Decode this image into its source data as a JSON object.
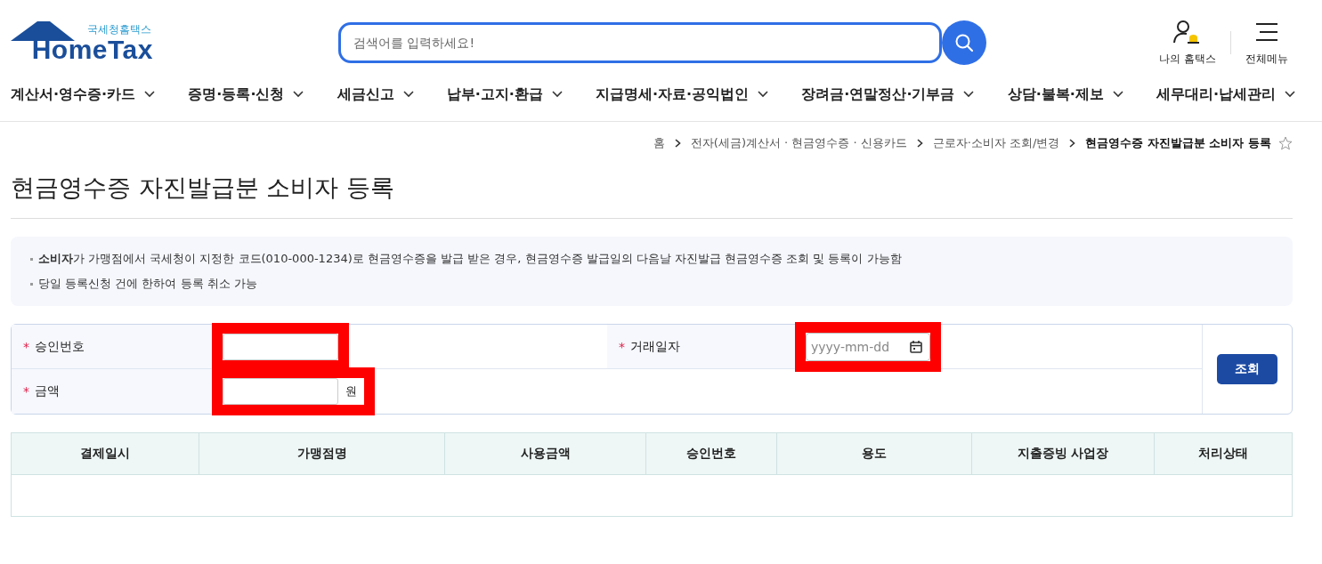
{
  "logo": {
    "subtitle": "국세청홈택스",
    "title": "HomeTax"
  },
  "search": {
    "placeholder": "검색어를 입력하세요!"
  },
  "header_links": [
    {
      "label": "나의 홈택스",
      "kind": "user"
    },
    {
      "label": "전체메뉴",
      "kind": "menu"
    }
  ],
  "nav": [
    "계산서·영수증·카드",
    "증명·등록·신청",
    "세금신고",
    "납부·고지·환급",
    "지급명세·자료·공익법인",
    "장려금·연말정산·기부금",
    "상담·불복·제보",
    "세무대리·납세관리"
  ],
  "breadcrumb": [
    {
      "label": "홈",
      "current": false
    },
    {
      "label": "전자(세금)계산서 · 현금영수증 · 신용카드",
      "current": false
    },
    {
      "label": "근로자·소비자 조회/변경",
      "current": false
    },
    {
      "label": "현금영수증 자진발급분 소비자 등록",
      "current": true
    }
  ],
  "page_title": "현금영수증 자진발급분 소비자 등록",
  "notices": [
    "**소비자**가 가맹점에서 국세청이 지정한 코드(010-000-1234)로 현금영수증을 발급 받은 경우, 현금영수증 발급일의 다음날 자진발급 현금영수증 조회 및 등록이 가능함",
    "당일 등록신청 건에 한하여 등록 취소 가능"
  ],
  "form": {
    "fields": [
      {
        "mark": "*",
        "label": "승인번호",
        "kind": "text",
        "highlighted": true
      },
      {
        "mark": "*",
        "label": "거래일자",
        "kind": "date",
        "placeholder": "yyyy-mm-dd",
        "highlighted": true
      },
      {
        "mark": "*",
        "label": "금액",
        "kind": "amount",
        "unit": "원",
        "highlighted": true
      }
    ],
    "button": "조회"
  },
  "table": {
    "columns": [
      "결제일시",
      "가맹점명",
      "사용금액",
      "승인번호",
      "용도",
      "지출증빙 사업장",
      "처리상태"
    ]
  }
}
